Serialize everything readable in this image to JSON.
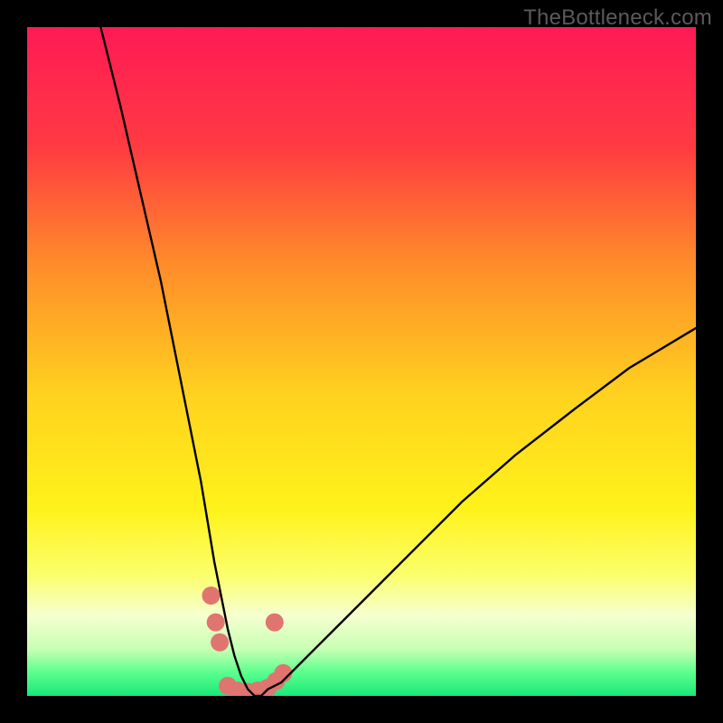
{
  "watermark": "TheBottleneck.com",
  "chart_data": {
    "type": "line",
    "title": "",
    "xlabel": "",
    "ylabel": "",
    "xlim": [
      0,
      100
    ],
    "ylim": [
      0,
      100
    ],
    "grid": false,
    "legend": false,
    "background_gradient_stops": [
      {
        "pos": 0.0,
        "color": "#ff1a55"
      },
      {
        "pos": 0.18,
        "color": "#ff3b42"
      },
      {
        "pos": 0.35,
        "color": "#ff8a2a"
      },
      {
        "pos": 0.55,
        "color": "#ffd21f"
      },
      {
        "pos": 0.72,
        "color": "#fff21a"
      },
      {
        "pos": 0.82,
        "color": "#fbff6d"
      },
      {
        "pos": 0.88,
        "color": "#f6ffd0"
      },
      {
        "pos": 0.93,
        "color": "#c7ffb3"
      },
      {
        "pos": 0.965,
        "color": "#5bff8e"
      },
      {
        "pos": 1.0,
        "color": "#19e87a"
      }
    ],
    "series": [
      {
        "name": "bottleneck-curve",
        "color": "#000000",
        "x": [
          11,
          14,
          17,
          20,
          22,
          24,
          26,
          27,
          28,
          29,
          30,
          31,
          32,
          33,
          34,
          35,
          36,
          38,
          40,
          43,
          47,
          52,
          58,
          65,
          73,
          82,
          90,
          100
        ],
        "y": [
          100,
          88,
          75,
          62,
          52,
          42,
          32,
          26,
          20,
          15,
          10,
          6,
          3,
          1,
          0,
          0,
          1,
          2,
          4,
          7,
          11,
          16,
          22,
          29,
          36,
          43,
          49,
          55
        ]
      }
    ],
    "markers": {
      "name": "highlight-dots",
      "color": "#e0756f",
      "radius": 10,
      "points": [
        {
          "x": 27.5,
          "y": 15
        },
        {
          "x": 28.2,
          "y": 11
        },
        {
          "x": 28.8,
          "y": 8
        },
        {
          "x": 30.0,
          "y": 1.5
        },
        {
          "x": 31.5,
          "y": 0.8
        },
        {
          "x": 33.0,
          "y": 0.6
        },
        {
          "x": 34.5,
          "y": 0.8
        },
        {
          "x": 36.0,
          "y": 1.2
        },
        {
          "x": 37.2,
          "y": 2.2
        },
        {
          "x": 38.3,
          "y": 3.4
        },
        {
          "x": 37.0,
          "y": 11
        }
      ]
    }
  }
}
